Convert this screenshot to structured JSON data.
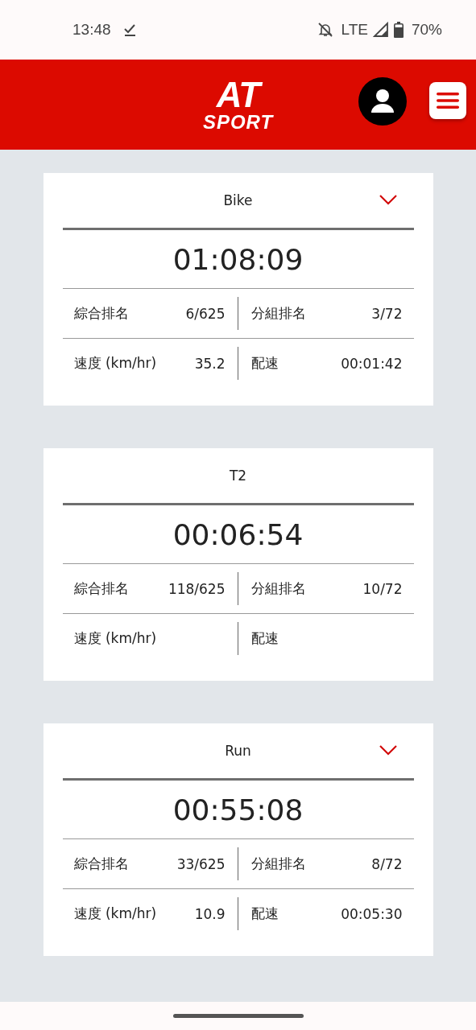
{
  "status_bar": {
    "time": "13:48",
    "network": "LTE",
    "battery": "70%"
  },
  "header": {
    "logo": {
      "top": "AT",
      "bottom": "SPORT"
    }
  },
  "splits": [
    {
      "title": "Bike",
      "collapsible": true,
      "time": "01:08:09",
      "stats": [
        {
          "label": "綜合排名",
          "value": "6/625"
        },
        {
          "label": "分組排名",
          "value": "3/72"
        },
        {
          "label": "速度 (km/hr)",
          "value": "35.2"
        },
        {
          "label": "配速",
          "value": "00:01:42"
        }
      ]
    },
    {
      "title": "T2",
      "collapsible": false,
      "time": "00:06:54",
      "stats": [
        {
          "label": "綜合排名",
          "value": "118/625"
        },
        {
          "label": "分組排名",
          "value": "10/72"
        },
        {
          "label": "速度 (km/hr)"
        },
        {
          "label": "配速"
        }
      ]
    },
    {
      "title": "Run",
      "collapsible": true,
      "time": "00:55:08",
      "stats": [
        {
          "label": "綜合排名",
          "value": "33/625"
        },
        {
          "label": "分組排名",
          "value": "8/72"
        },
        {
          "label": "速度 (km/hr)",
          "value": "10.9"
        },
        {
          "label": "配速",
          "value": "00:05:30"
        }
      ]
    }
  ]
}
